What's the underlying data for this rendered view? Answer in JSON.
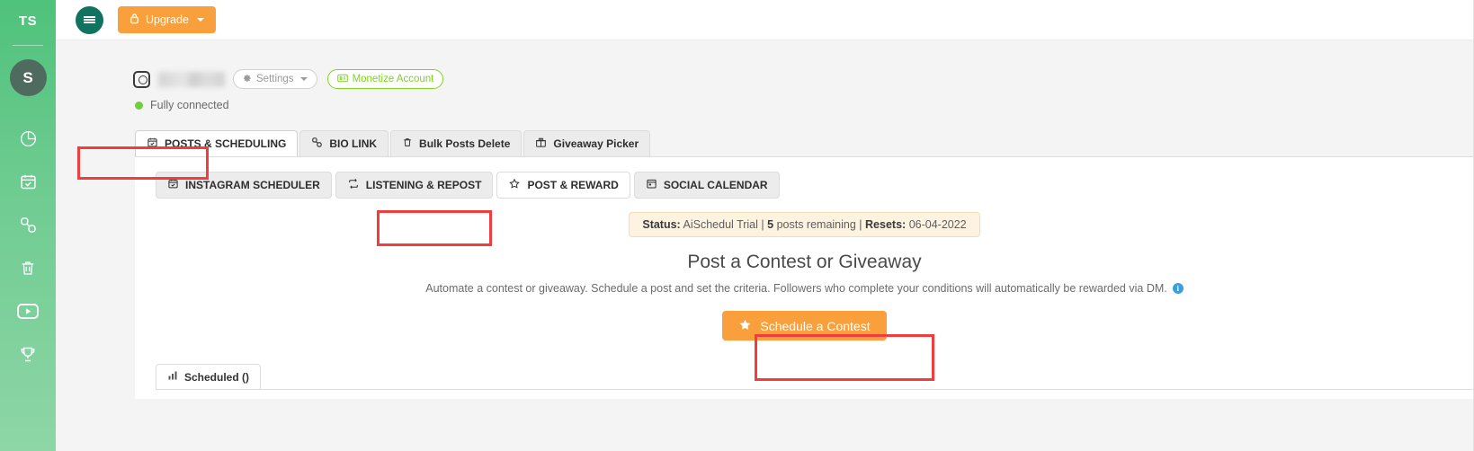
{
  "sidebar": {
    "brand": "TS",
    "avatar_initial": "S",
    "items": [
      {
        "icon": "pie-chart-icon",
        "label": "Analytics"
      },
      {
        "icon": "calendar-check-icon",
        "label": "Scheduler"
      },
      {
        "icon": "link-chain-icon",
        "label": "Bio Link"
      },
      {
        "icon": "trash-icon",
        "label": "Bulk Delete"
      },
      {
        "icon": "youtube-icon",
        "label": "YouTube"
      },
      {
        "icon": "trophy-icon",
        "label": "Giveaway"
      }
    ]
  },
  "topbar": {
    "menu_icon": "hamburger-icon",
    "upgrade_label": "Upgrade",
    "upgrade_icon": "lock-icon"
  },
  "account": {
    "platform_icon": "instagram-icon",
    "name_masked": "",
    "settings_label": "Settings",
    "settings_icon": "gear-icon",
    "monetize_label": "Monetize Account",
    "monetize_icon": "card-icon",
    "connection_status": "Fully connected"
  },
  "primary_tabs": [
    {
      "label": "POSTS & SCHEDULING",
      "icon": "calendar-check-icon",
      "active": true
    },
    {
      "label": "BIO LINK",
      "icon": "link-chain-icon",
      "active": false
    },
    {
      "label": "Bulk Posts Delete",
      "icon": "trash-icon",
      "active": false
    },
    {
      "label": "Giveaway Picker",
      "icon": "gift-icon",
      "active": false
    }
  ],
  "sub_tabs": [
    {
      "label": "INSTAGRAM SCHEDULER",
      "icon": "calendar-icon",
      "active": false
    },
    {
      "label": "LISTENING & REPOST",
      "icon": "repost-icon",
      "active": false
    },
    {
      "label": "POST & REWARD",
      "icon": "star-outline-icon",
      "active": true
    },
    {
      "label": "SOCIAL CALENDAR",
      "icon": "calendar-grid-icon",
      "active": false
    }
  ],
  "status_banner": {
    "status_label": "Status:",
    "status_value": "AiSchedul Trial",
    "sep1": "|",
    "posts_remaining_count": "5",
    "posts_remaining_text": "posts remaining",
    "sep2": "|",
    "resets_label": "Resets:",
    "resets_value": "06-04-2022"
  },
  "hero": {
    "title": "Post a Contest or Giveaway",
    "description": "Automate a contest or giveaway. Schedule a post and set the criteria. Followers who complete your conditions will automatically be rewarded via DM.",
    "info_icon": "info-icon",
    "cta_label": "Schedule a Contest",
    "cta_icon": "star-filled-icon"
  },
  "scheduled_tab": {
    "label": "Scheduled ()",
    "icon": "bar-chart-icon"
  },
  "colors": {
    "sidebar_green": "#4fc27b",
    "accent_orange": "#f9a03c",
    "monetize_green": "#7ed321",
    "annotation_red": "#f03e3e",
    "banner_bg": "#fdf3e0",
    "hamburger_teal": "#11735f"
  },
  "annotations": [
    {
      "name": "posts-scheduling-tab-highlight"
    },
    {
      "name": "post-reward-tab-highlight"
    },
    {
      "name": "schedule-contest-button-highlight"
    }
  ]
}
